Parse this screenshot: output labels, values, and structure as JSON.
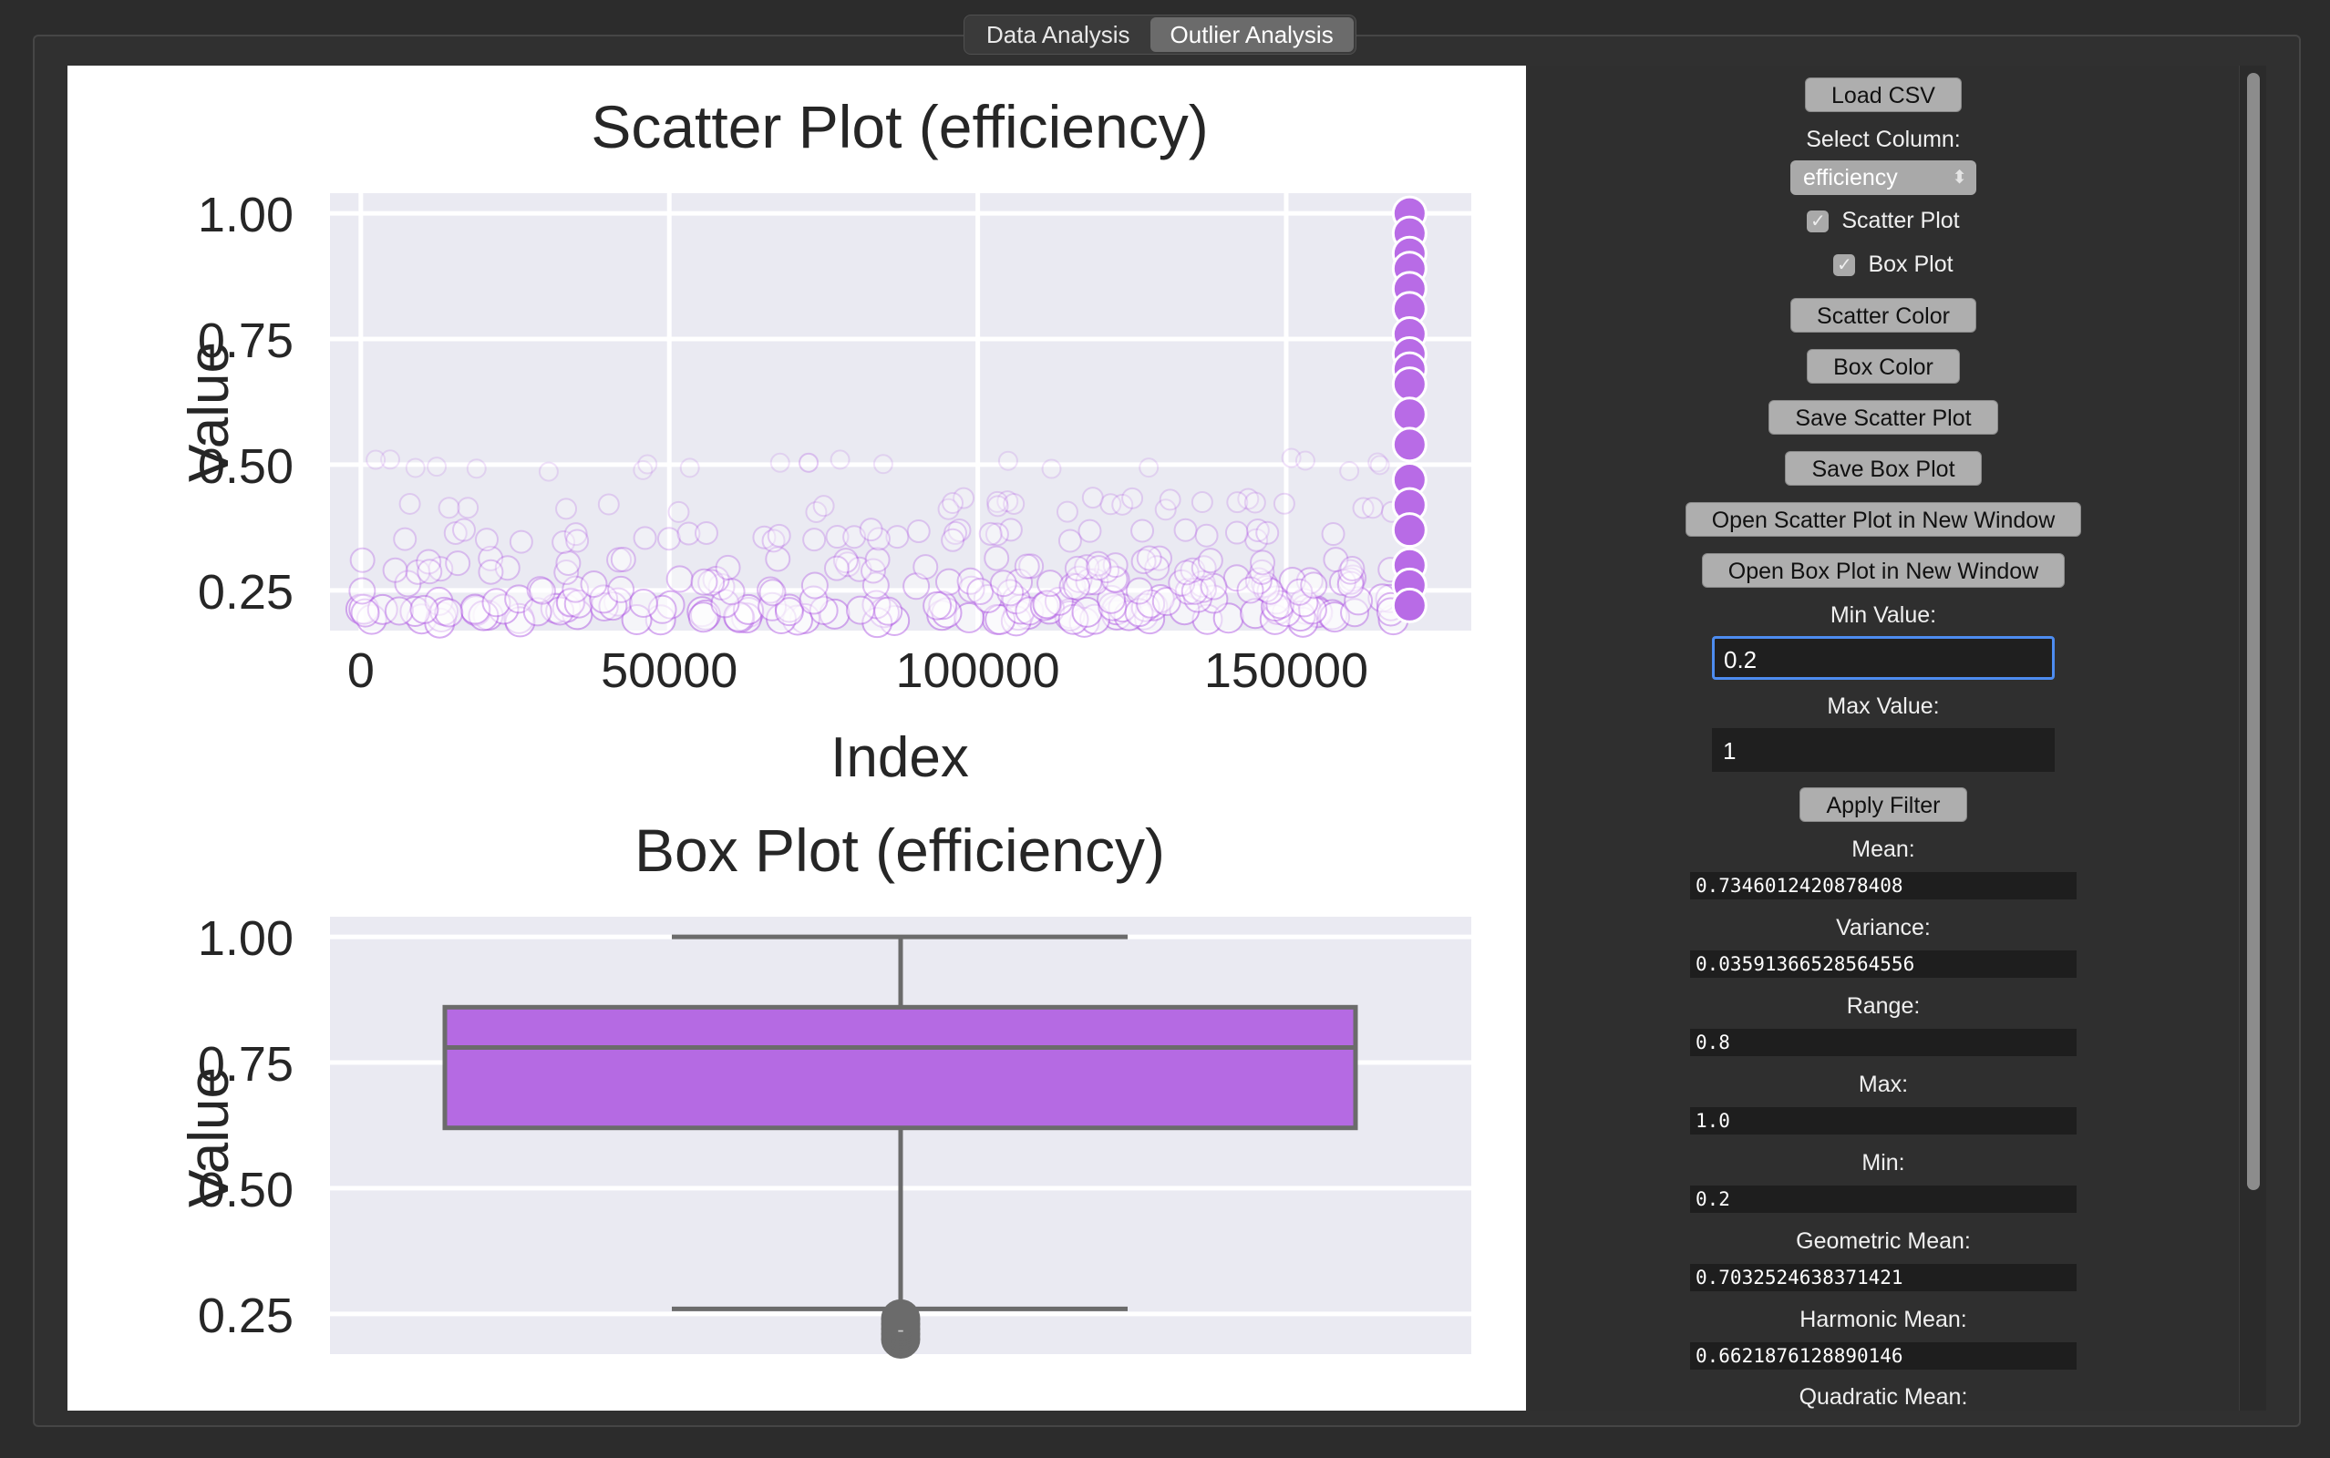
{
  "tabs": [
    {
      "label": "Data Analysis",
      "active": false
    },
    {
      "label": "Outlier Analysis",
      "active": true
    }
  ],
  "controls": {
    "load_csv": "Load CSV",
    "select_column_label": "Select Column:",
    "selected_column": "efficiency",
    "scatter_checkbox": "Scatter Plot",
    "box_checkbox": "Box Plot",
    "scatter_color": "Scatter Color",
    "box_color": "Box Color",
    "save_scatter": "Save Scatter Plot",
    "save_box": "Save Box Plot",
    "open_scatter": "Open Scatter Plot in New Window",
    "open_box": "Open Box Plot in New Window",
    "min_label": "Min Value:",
    "min_value": "0.2",
    "max_label": "Max Value:",
    "max_value": "1",
    "apply_filter": "Apply Filter"
  },
  "stats": [
    {
      "label": "Mean:",
      "value": "0.7346012420878408"
    },
    {
      "label": "Variance:",
      "value": "0.03591366528564556"
    },
    {
      "label": "Range:",
      "value": "0.8"
    },
    {
      "label": "Max:",
      "value": "1.0"
    },
    {
      "label": "Min:",
      "value": "0.2"
    },
    {
      "label": "Geometric Mean:",
      "value": "0.7032524638371421"
    },
    {
      "label": "Harmonic Mean:",
      "value": "0.6621876128890146"
    },
    {
      "label": "Quadratic Mean:",
      "value": ""
    }
  ],
  "colors": {
    "point": "#b86be6",
    "box_fill": "#b56ae3",
    "box_line": "#6b6b6b",
    "plot_bg": "#eaeaf2"
  },
  "chart_data": [
    {
      "type": "scatter",
      "title": "Scatter Plot (efficiency)",
      "xlabel": "Index",
      "ylabel": "Value",
      "xlim": [
        -5000,
        180000
      ],
      "ylim": [
        0.17,
        1.04
      ],
      "xticks": [
        0,
        50000,
        100000,
        150000
      ],
      "xtick_labels": [
        "0",
        "50000",
        "100000",
        "150000"
      ],
      "yticks": [
        0.25,
        0.5,
        0.75,
        1.0
      ],
      "ytick_labels": [
        "0.25",
        "0.50",
        "0.75",
        "1.00"
      ],
      "grid": true,
      "outlier_points": [
        {
          "x": 170000,
          "y": 1.0
        },
        {
          "x": 170000,
          "y": 0.96
        },
        {
          "x": 170000,
          "y": 0.92
        },
        {
          "x": 170000,
          "y": 0.89
        },
        {
          "x": 170000,
          "y": 0.85
        },
        {
          "x": 170000,
          "y": 0.81
        },
        {
          "x": 170000,
          "y": 0.76
        },
        {
          "x": 170000,
          "y": 0.72
        },
        {
          "x": 170000,
          "y": 0.69
        },
        {
          "x": 170000,
          "y": 0.66
        },
        {
          "x": 170000,
          "y": 0.6
        },
        {
          "x": 170000,
          "y": 0.54
        },
        {
          "x": 170000,
          "y": 0.47
        },
        {
          "x": 170000,
          "y": 0.42
        },
        {
          "x": 170000,
          "y": 0.37
        },
        {
          "x": 170000,
          "y": 0.3
        },
        {
          "x": 170000,
          "y": 0.26
        },
        {
          "x": 170000,
          "y": 0.22
        }
      ],
      "bulk_density": [
        {
          "y": 0.2,
          "x_from": 0,
          "x_to": 168000
        },
        {
          "y": 0.22,
          "x_from": 0,
          "x_to": 168000
        },
        {
          "y": 0.26,
          "x_from": 0,
          "x_to": 168000
        },
        {
          "y": 0.3,
          "x_from": 0,
          "x_to": 168000
        },
        {
          "y": 0.36,
          "x_from": 0,
          "x_to": 168000
        },
        {
          "y": 0.42,
          "x_from": 0,
          "x_to": 168000
        },
        {
          "y": 0.5,
          "x_from": 0,
          "x_to": 168000
        }
      ]
    },
    {
      "type": "box",
      "title": "Box Plot (efficiency)",
      "xlabel": "",
      "ylabel": "Value",
      "ylim": [
        0.17,
        1.04
      ],
      "yticks": [
        0.25,
        0.5,
        0.75,
        1.0
      ],
      "ytick_labels": [
        "0.25",
        "0.50",
        "0.75",
        "1.00"
      ],
      "whisker_low": 0.26,
      "q1": 0.62,
      "median": 0.78,
      "q3": 0.86,
      "whisker_high": 1.0,
      "outliers": [
        0.2,
        0.21,
        0.22,
        0.23,
        0.24
      ],
      "outlier_label": "-"
    }
  ]
}
